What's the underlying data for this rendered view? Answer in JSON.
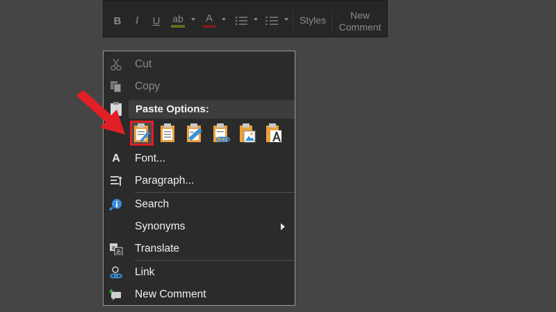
{
  "colors": {
    "background": "#454545",
    "menu_bg": "#2b2b2b",
    "text": "#f0f0f0",
    "disabled_text": "#8a8a8a",
    "highlight_red": "#e21f26",
    "clipboard_orange": "#e9a23b",
    "link_blue": "#3a8fd8"
  },
  "mini_toolbar": {
    "bold": "B",
    "italic": "I",
    "underline": "U",
    "highlight": "ab",
    "font_color": "A",
    "styles_label": "Styles",
    "new_comment_label_line1": "New",
    "new_comment_label_line2": "Comment"
  },
  "context_menu": {
    "cut": "Cut",
    "copy": "Copy",
    "paste_options_header": "Paste Options:",
    "paste_options": [
      {
        "icon": "keep-source-formatting-icon",
        "selected": true
      },
      {
        "icon": "paste-icon"
      },
      {
        "icon": "merge-formatting-icon"
      },
      {
        "icon": "keep-text-link-icon"
      },
      {
        "icon": "picture-icon"
      },
      {
        "icon": "keep-text-only-icon"
      }
    ],
    "font": "Font...",
    "paragraph": "Paragraph...",
    "search": "Search",
    "synonyms": "Synonyms",
    "translate": "Translate",
    "link": "Link",
    "new_comment": "New Comment"
  }
}
